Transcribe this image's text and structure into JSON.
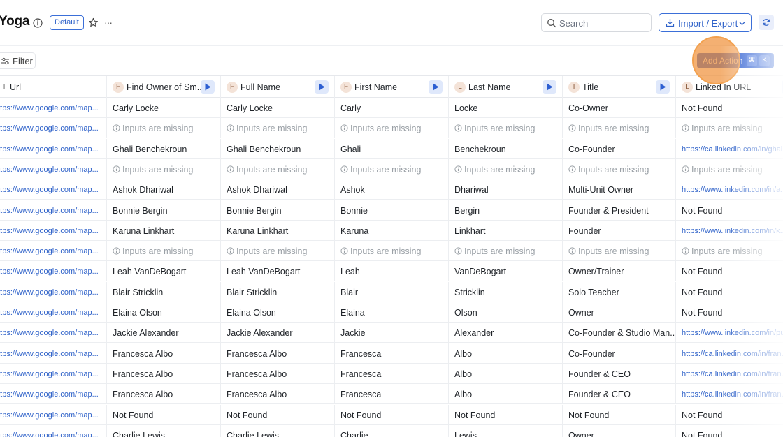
{
  "header": {
    "title": "Yoga",
    "badge": "Default",
    "more": "···",
    "search_placeholder": "Search",
    "import_export_label": "Import / Export"
  },
  "toolbar": {
    "filter_label": "Filter",
    "add_action_label": "Add Action",
    "shortcut_keys": [
      "⌘",
      "K"
    ]
  },
  "columns": [
    {
      "label": "Url",
      "type": "T",
      "run": false
    },
    {
      "label": "Find Owner of Sm...",
      "type": "F",
      "run": true
    },
    {
      "label": "Full Name",
      "type": "F",
      "run": true
    },
    {
      "label": "First Name",
      "type": "F",
      "run": true
    },
    {
      "label": "Last Name",
      "type": "L",
      "run": true
    },
    {
      "label": "Title",
      "type": "T",
      "run": true
    },
    {
      "label": "Linked In URL",
      "type": "L",
      "run": true
    }
  ],
  "missing_text": "Inputs are missing",
  "rows": [
    {
      "url": "https://www.google.com/map...",
      "owner": "Carly Locke",
      "full": "Carly Locke",
      "first": "Carly",
      "last": "Locke",
      "title": "Co-Owner",
      "linkedin": "Not Found"
    },
    {
      "url": "https://www.google.com/map...",
      "missing": true
    },
    {
      "url": "https://www.google.com/map...",
      "owner": "Ghali Benchekroun",
      "full": "Ghali Benchekroun",
      "first": "Ghali",
      "last": "Benchekroun",
      "title": "Co-Founder",
      "linkedin": "https://ca.linkedin.com/in/ghal..."
    },
    {
      "url": "https://www.google.com/map...",
      "missing": true
    },
    {
      "url": "https://www.google.com/map...",
      "owner": "Ashok Dhariwal",
      "full": "Ashok Dhariwal",
      "first": "Ashok",
      "last": "Dhariwal",
      "title": "Multi-Unit Owner",
      "linkedin": "https://www.linkedin.com/in/a..."
    },
    {
      "url": "https://www.google.com/map...",
      "owner": "Bonnie Bergin",
      "full": "Bonnie Bergin",
      "first": "Bonnie",
      "last": "Bergin",
      "title": "Founder & President",
      "linkedin": "Not Found"
    },
    {
      "url": "https://www.google.com/map...",
      "owner": "Karuna Linkhart",
      "full": "Karuna Linkhart",
      "first": "Karuna",
      "last": "Linkhart",
      "title": "Founder",
      "linkedin": "https://www.linkedin.com/in/k..."
    },
    {
      "url": "https://www.google.com/map...",
      "missing": true
    },
    {
      "url": "https://www.google.com/map...",
      "owner": "Leah VanDeBogart",
      "full": "Leah VanDeBogart",
      "first": "Leah",
      "last": "VanDeBogart",
      "title": "Owner/Trainer",
      "linkedin": "Not Found"
    },
    {
      "url": "https://www.google.com/map...",
      "owner": "Blair Stricklin",
      "full": "Blair Stricklin",
      "first": "Blair",
      "last": "Stricklin",
      "title": "Solo Teacher",
      "linkedin": "Not Found"
    },
    {
      "url": "https://www.google.com/map...",
      "owner": "Elaina Olson",
      "full": "Elaina Olson",
      "first": "Elaina",
      "last": "Olson",
      "title": "Owner",
      "linkedin": "Not Found"
    },
    {
      "url": "https://www.google.com/map...",
      "owner": "Jackie Alexander",
      "full": "Jackie Alexander",
      "first": "Jackie",
      "last": "Alexander",
      "title": "Co-Founder & Studio Man...",
      "linkedin": "https://www.linkedin.com/in/puls..."
    },
    {
      "url": "https://www.google.com/map...",
      "owner": "Francesca Albo",
      "full": "Francesca Albo",
      "first": "Francesca",
      "last": "Albo",
      "title": "Co-Founder",
      "linkedin": "https://ca.linkedin.com/in/fran..."
    },
    {
      "url": "https://www.google.com/map...",
      "owner": "Francesca Albo",
      "full": "Francesca Albo",
      "first": "Francesca",
      "last": "Albo",
      "title": "Founder & CEO",
      "linkedin": "https://ca.linkedin.com/in/fran..."
    },
    {
      "url": "https://www.google.com/map...",
      "owner": "Francesca Albo",
      "full": "Francesca Albo",
      "first": "Francesca",
      "last": "Albo",
      "title": "Founder & CEO",
      "linkedin": "https://ca.linkedin.com/in/fran..."
    },
    {
      "url": "https://www.google.com/map...",
      "owner": "Not Found",
      "full": "Not Found",
      "first": "Not Found",
      "last": "Not Found",
      "title": "Not Found",
      "linkedin": "Not Found"
    },
    {
      "url": "https://www.google.com/map...",
      "owner": "Charlie Lewis",
      "full": "Charlie Lewis",
      "first": "Charlie",
      "last": "Lewis",
      "title": "Owner",
      "linkedin": "Not Found"
    }
  ]
}
